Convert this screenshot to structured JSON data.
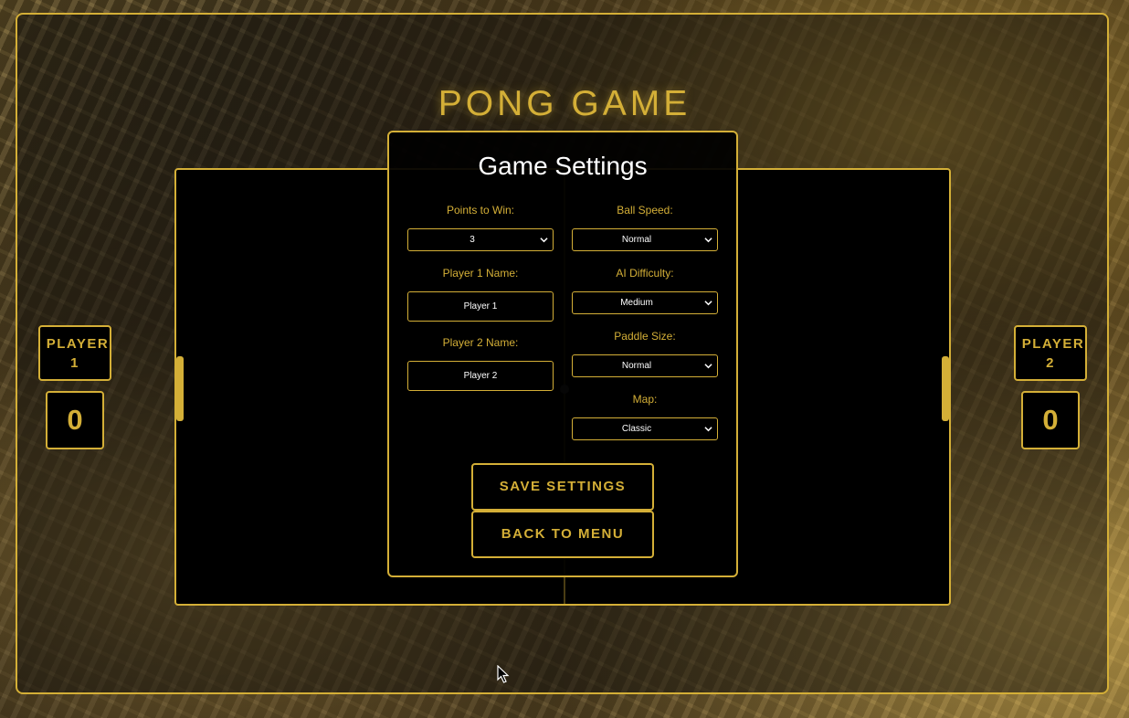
{
  "game_title": "PONG GAME",
  "scoreboard": {
    "player1": {
      "label_word": "PLAYER",
      "label_num": "1",
      "score": "0"
    },
    "player2": {
      "label_word": "PLAYER",
      "label_num": "2",
      "score": "0"
    }
  },
  "settings": {
    "title": "Game Settings",
    "points_to_win": {
      "label": "Points to Win:",
      "value": "3"
    },
    "ball_speed": {
      "label": "Ball Speed:",
      "value": "Normal"
    },
    "player1_name": {
      "label": "Player 1 Name:",
      "value": "Player 1"
    },
    "ai_difficulty": {
      "label": "AI Difficulty:",
      "value": "Medium"
    },
    "player2_name": {
      "label": "Player 2 Name:",
      "value": "Player 2"
    },
    "paddle_size": {
      "label": "Paddle Size:",
      "value": "Normal"
    },
    "map": {
      "label": "Map:",
      "value": "Classic"
    },
    "save_button": "SAVE SETTINGS",
    "back_button": "BACK TO MENU"
  },
  "colors": {
    "accent": "#d4af37",
    "panel": "#000000",
    "text": "#ffffff"
  }
}
